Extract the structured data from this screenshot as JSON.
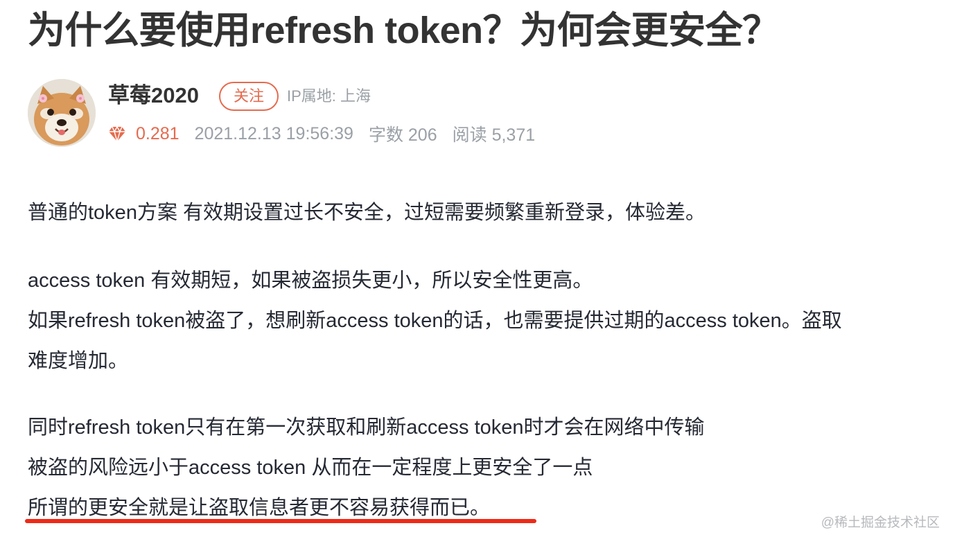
{
  "article": {
    "title": "为什么要使用refresh token？为何会更安全？"
  },
  "author": {
    "name": "草莓2020",
    "follow_label": "关注",
    "ip_location": "IP属地: 上海",
    "avatar_icon": "shiba-dog-avatar"
  },
  "meta": {
    "diamond_icon": "diamond-icon",
    "score": "0.281",
    "datetime": "2021.12.13 19:56:39",
    "word_count": "字数 206",
    "reads": "阅读 5,371"
  },
  "content": {
    "paragraph1": "普通的token方案 有效期设置过长不安全，过短需要频繁重新登录，体验差。",
    "paragraph2_line1": "access token 有效期短，如果被盗损失更小，所以安全性更高。",
    "paragraph2_line2": "如果refresh token被盗了，想刷新access token的话，也需要提供过期的access token。盗取",
    "paragraph2_line3": "难度增加。",
    "paragraph3_line1": "同时refresh token只有在第一次获取和刷新access token时才会在网络中传输",
    "paragraph3_line2": "被盗的风险远小于access token 从而在一定程度上更安全了一点",
    "paragraph3_line3": "所谓的更安全就是让盗取信息者更不容易获得而已。"
  },
  "watermark": "@稀土掘金技术社区",
  "colors": {
    "accent": "#e56b4e",
    "underline": "#ee2a17",
    "muted": "#9aa0a6"
  }
}
